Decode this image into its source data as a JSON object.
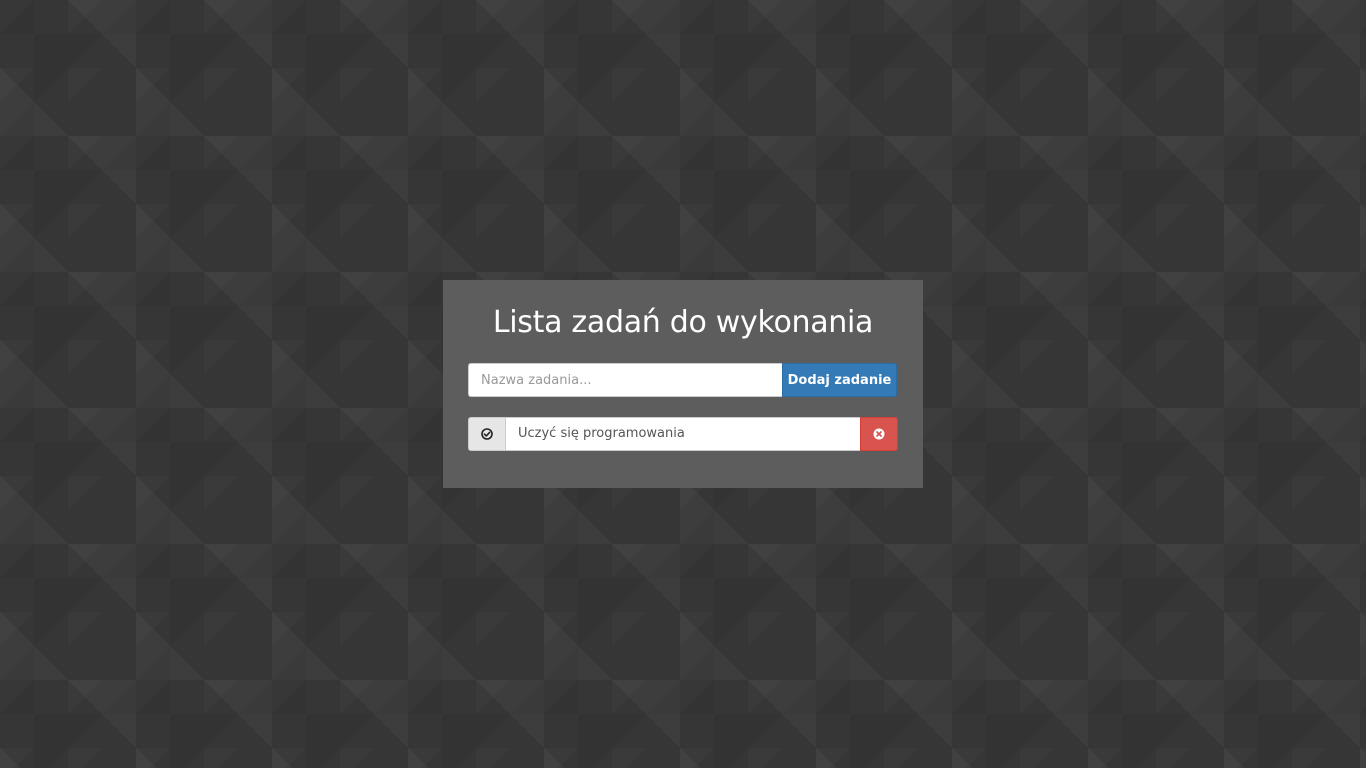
{
  "app": {
    "title": "Lista zadań do wykonania"
  },
  "add_form": {
    "input_value": "",
    "input_placeholder": "Nazwa zadania...",
    "add_button_label": "Dodaj zadanie"
  },
  "tasks": [
    {
      "label": "Uczyć się programowania",
      "done_icon": "check-circle-icon",
      "delete_icon": "times-circle-icon"
    }
  ],
  "colors": {
    "background": "#363636",
    "panel": "#5d5d5d",
    "primary": "#337ab7",
    "danger": "#d9534f",
    "addon": "#e6e6e6"
  }
}
